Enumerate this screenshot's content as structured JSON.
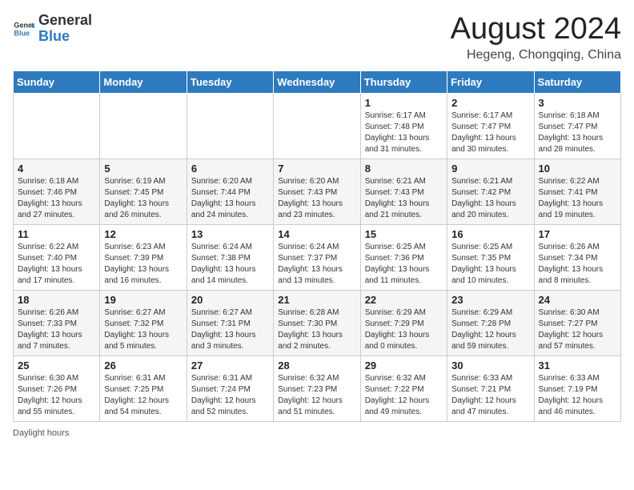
{
  "header": {
    "logo_general": "General",
    "logo_blue": "Blue",
    "month_year": "August 2024",
    "location": "Hegeng, Chongqing, China"
  },
  "days_of_week": [
    "Sunday",
    "Monday",
    "Tuesday",
    "Wednesday",
    "Thursday",
    "Friday",
    "Saturday"
  ],
  "weeks": [
    [
      {
        "day": "",
        "sunrise": "",
        "sunset": "",
        "daylight": ""
      },
      {
        "day": "",
        "sunrise": "",
        "sunset": "",
        "daylight": ""
      },
      {
        "day": "",
        "sunrise": "",
        "sunset": "",
        "daylight": ""
      },
      {
        "day": "",
        "sunrise": "",
        "sunset": "",
        "daylight": ""
      },
      {
        "day": "1",
        "sunrise": "6:17 AM",
        "sunset": "7:48 PM",
        "daylight": "13 hours and 31 minutes."
      },
      {
        "day": "2",
        "sunrise": "6:17 AM",
        "sunset": "7:47 PM",
        "daylight": "13 hours and 30 minutes."
      },
      {
        "day": "3",
        "sunrise": "6:18 AM",
        "sunset": "7:47 PM",
        "daylight": "13 hours and 28 minutes."
      }
    ],
    [
      {
        "day": "4",
        "sunrise": "6:18 AM",
        "sunset": "7:46 PM",
        "daylight": "13 hours and 27 minutes."
      },
      {
        "day": "5",
        "sunrise": "6:19 AM",
        "sunset": "7:45 PM",
        "daylight": "13 hours and 26 minutes."
      },
      {
        "day": "6",
        "sunrise": "6:20 AM",
        "sunset": "7:44 PM",
        "daylight": "13 hours and 24 minutes."
      },
      {
        "day": "7",
        "sunrise": "6:20 AM",
        "sunset": "7:43 PM",
        "daylight": "13 hours and 23 minutes."
      },
      {
        "day": "8",
        "sunrise": "6:21 AM",
        "sunset": "7:43 PM",
        "daylight": "13 hours and 21 minutes."
      },
      {
        "day": "9",
        "sunrise": "6:21 AM",
        "sunset": "7:42 PM",
        "daylight": "13 hours and 20 minutes."
      },
      {
        "day": "10",
        "sunrise": "6:22 AM",
        "sunset": "7:41 PM",
        "daylight": "13 hours and 19 minutes."
      }
    ],
    [
      {
        "day": "11",
        "sunrise": "6:22 AM",
        "sunset": "7:40 PM",
        "daylight": "13 hours and 17 minutes."
      },
      {
        "day": "12",
        "sunrise": "6:23 AM",
        "sunset": "7:39 PM",
        "daylight": "13 hours and 16 minutes."
      },
      {
        "day": "13",
        "sunrise": "6:24 AM",
        "sunset": "7:38 PM",
        "daylight": "13 hours and 14 minutes."
      },
      {
        "day": "14",
        "sunrise": "6:24 AM",
        "sunset": "7:37 PM",
        "daylight": "13 hours and 13 minutes."
      },
      {
        "day": "15",
        "sunrise": "6:25 AM",
        "sunset": "7:36 PM",
        "daylight": "13 hours and 11 minutes."
      },
      {
        "day": "16",
        "sunrise": "6:25 AM",
        "sunset": "7:35 PM",
        "daylight": "13 hours and 10 minutes."
      },
      {
        "day": "17",
        "sunrise": "6:26 AM",
        "sunset": "7:34 PM",
        "daylight": "13 hours and 8 minutes."
      }
    ],
    [
      {
        "day": "18",
        "sunrise": "6:26 AM",
        "sunset": "7:33 PM",
        "daylight": "13 hours and 7 minutes."
      },
      {
        "day": "19",
        "sunrise": "6:27 AM",
        "sunset": "7:32 PM",
        "daylight": "13 hours and 5 minutes."
      },
      {
        "day": "20",
        "sunrise": "6:27 AM",
        "sunset": "7:31 PM",
        "daylight": "13 hours and 3 minutes."
      },
      {
        "day": "21",
        "sunrise": "6:28 AM",
        "sunset": "7:30 PM",
        "daylight": "13 hours and 2 minutes."
      },
      {
        "day": "22",
        "sunrise": "6:29 AM",
        "sunset": "7:29 PM",
        "daylight": "13 hours and 0 minutes."
      },
      {
        "day": "23",
        "sunrise": "6:29 AM",
        "sunset": "7:28 PM",
        "daylight": "12 hours and 59 minutes."
      },
      {
        "day": "24",
        "sunrise": "6:30 AM",
        "sunset": "7:27 PM",
        "daylight": "12 hours and 57 minutes."
      }
    ],
    [
      {
        "day": "25",
        "sunrise": "6:30 AM",
        "sunset": "7:26 PM",
        "daylight": "12 hours and 55 minutes."
      },
      {
        "day": "26",
        "sunrise": "6:31 AM",
        "sunset": "7:25 PM",
        "daylight": "12 hours and 54 minutes."
      },
      {
        "day": "27",
        "sunrise": "6:31 AM",
        "sunset": "7:24 PM",
        "daylight": "12 hours and 52 minutes."
      },
      {
        "day": "28",
        "sunrise": "6:32 AM",
        "sunset": "7:23 PM",
        "daylight": "12 hours and 51 minutes."
      },
      {
        "day": "29",
        "sunrise": "6:32 AM",
        "sunset": "7:22 PM",
        "daylight": "12 hours and 49 minutes."
      },
      {
        "day": "30",
        "sunrise": "6:33 AM",
        "sunset": "7:21 PM",
        "daylight": "12 hours and 47 minutes."
      },
      {
        "day": "31",
        "sunrise": "6:33 AM",
        "sunset": "7:19 PM",
        "daylight": "12 hours and 46 minutes."
      }
    ]
  ],
  "footer": {
    "daylight_label": "Daylight hours"
  }
}
